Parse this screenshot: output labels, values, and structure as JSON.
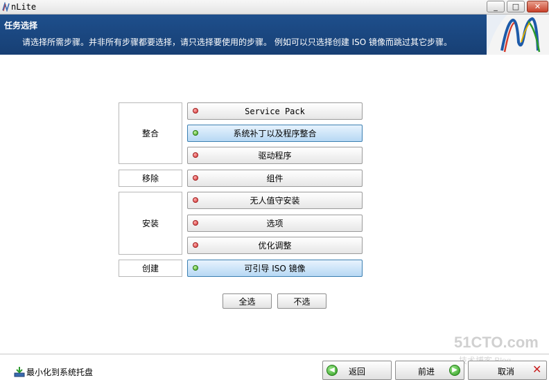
{
  "window": {
    "title": "nLite",
    "minimize_glyph": "_",
    "maximize_glyph": "□",
    "close_glyph": "✕"
  },
  "header": {
    "title": "任务选择",
    "description": "请选择所需步骤。并非所有步骤都要选择，请只选择要使用的步骤。 例如可以只选择创建 ISO 镜像而跳过其它步骤。"
  },
  "groups": [
    {
      "label": "整合"
    },
    {
      "label": "移除"
    },
    {
      "label": "安装"
    },
    {
      "label": "创建"
    }
  ],
  "tasks": [
    {
      "label": "Service Pack",
      "selected": false
    },
    {
      "label": "系统补丁以及程序整合",
      "selected": true
    },
    {
      "label": "驱动程序",
      "selected": false
    },
    {
      "label": "组件",
      "selected": false
    },
    {
      "label": "无人值守安装",
      "selected": false
    },
    {
      "label": "选项",
      "selected": false
    },
    {
      "label": "优化调整",
      "selected": false
    },
    {
      "label": "可引导 ISO 镜像",
      "selected": true
    }
  ],
  "selection": {
    "select_all_label": "全选",
    "select_none_label": "不选"
  },
  "footer": {
    "tray_label": "最小化到系统托盘",
    "back_label": "返回",
    "next_label": "前进",
    "cancel_label": "取消"
  },
  "watermark": {
    "line1": "51CTO.com",
    "line2": "技术博客 Blog"
  },
  "colors": {
    "header_bg": "#1e4f8c",
    "dot_unselected": "#d23030",
    "dot_selected": "#3aa018",
    "selected_bg": "#b7d8f4"
  }
}
